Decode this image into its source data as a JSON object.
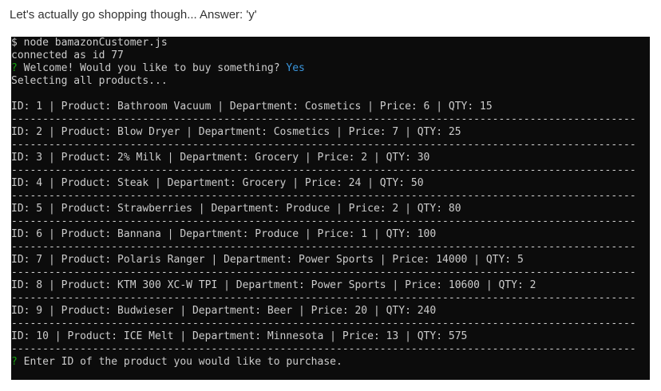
{
  "caption": "Let's actually go shopping though... Answer: 'y'",
  "terminal": {
    "command": "$ node bamazonCustomer.js",
    "connected": "connected as id 77",
    "prompt_marker": "?",
    "welcome_question": " Welcome! Would you like to buy something? ",
    "welcome_answer": "Yes",
    "selecting": "Selecting all products...",
    "separator": "----------------------------------------------------------------------------------------------------",
    "rows": [
      "ID: 1 | Product: Bathroom Vacuum | Department: Cosmetics | Price: 6 | QTY: 15",
      "ID: 2 | Product: Blow Dryer | Department: Cosmetics | Price: 7 | QTY: 25",
      "ID: 3 | Product: 2% Milk | Department: Grocery | Price: 2 | QTY: 30",
      "ID: 4 | Product: Steak | Department: Grocery | Price: 24 | QTY: 50",
      "ID: 5 | Product: Strawberries | Department: Produce | Price: 2 | QTY: 80",
      "ID: 6 | Product: Bannana | Department: Produce | Price: 1 | QTY: 100",
      "ID: 7 | Product: Polaris Ranger | Department: Power Sports | Price: 14000 | QTY: 5",
      "ID: 8 | Product: KTM 300 XC-W TPI | Department: Power Sports | Price: 10600 | QTY: 2",
      "ID: 9 | Product: Budwieser | Department: Beer | Price: 20 | QTY: 240",
      "ID: 10 | Product: ICE Melt | Department: Minnesota | Price: 13 | QTY: 575"
    ],
    "final_prompt": " Enter ID of the product you would like to purchase."
  },
  "colors": {
    "terminal_bg": "#0c0c0c",
    "terminal_text": "#cccccc",
    "prompt_green": "#13a10e",
    "answer_teal": "#3a96dd"
  }
}
